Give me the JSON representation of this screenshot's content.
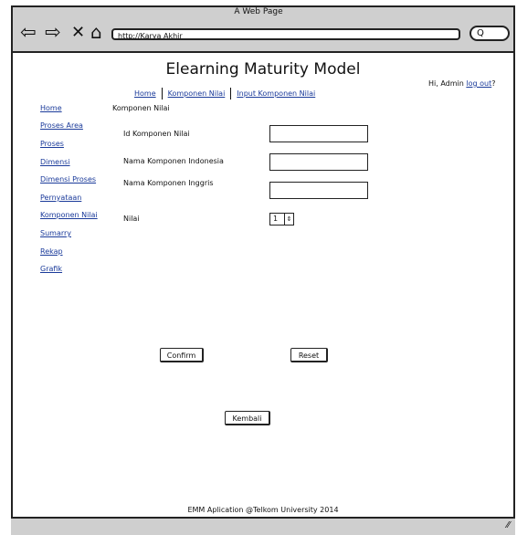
{
  "window": {
    "title": "A Web Page"
  },
  "browser": {
    "url": "http://Karya Akhir",
    "search_label": "Q"
  },
  "icons": {
    "back": "back-arrow-icon",
    "forward": "forward-arrow-icon",
    "close": "close-icon",
    "home": "home-icon",
    "search": "search-icon",
    "resize": "resize-grip-icon"
  },
  "page": {
    "title": "Elearning Maturity Model"
  },
  "user": {
    "greeting": "Hi, Admin",
    "logout": "log out",
    "suffix": "?"
  },
  "topnav": {
    "home": "Home",
    "komponen_nilai": "Komponen Nilai",
    "input_komponen": "Input Komponen Nilai"
  },
  "sidebar": {
    "items": [
      {
        "label": "Home"
      },
      {
        "label": "Proses Area"
      },
      {
        "label": "Proses"
      },
      {
        "label": "Dimensi"
      },
      {
        "label": "Dimensi Proses"
      },
      {
        "label": "Pernyataan"
      },
      {
        "label": "Komponen Nilai"
      },
      {
        "label": "Sumarry"
      },
      {
        "label": "Rekap"
      },
      {
        "label": "Grafik"
      }
    ]
  },
  "breadcrumb": "Komponen Nilai",
  "form": {
    "id_label": "Id Komponen Nilai",
    "id_value": "",
    "nama_indo_label": "Nama Komponen Indonesia",
    "nama_indo_value": "",
    "nama_inggris_label": "Nama Komponen Inggris",
    "nama_inggris_value": "",
    "nilai_label": "Nilai",
    "nilai_value": "1"
  },
  "buttons": {
    "confirm": "Confirm",
    "reset": "Reset",
    "kembali": "Kembali"
  },
  "footer": "EMM Aplication @Telkom University 2014"
}
